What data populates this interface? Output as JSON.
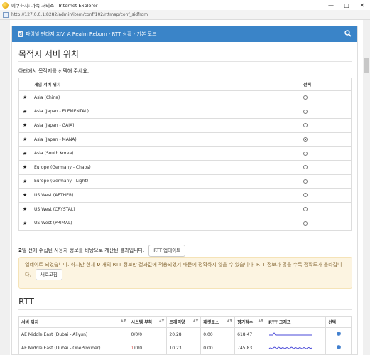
{
  "window": {
    "title": "미쿠하지: 가속 서비스 - Internet Explorer",
    "url": "http://127.0.0.1:8282/admin/item/conf/102/rttmap/conf_sidfrom"
  },
  "navbar": {
    "brand": "파이널 판타지 XIV: A Realm Reborn - RTT 상황 - 기본 모드"
  },
  "section": {
    "title": "목적지 서버 위치",
    "instruction": "아래에서 목적지를 선택해 주세요."
  },
  "server_table": {
    "headers": [
      "게임 서버 위치",
      "선택"
    ],
    "rows": [
      {
        "name": "Asia (China)",
        "selected": false
      },
      {
        "name": "Asia (Japan - ELEMENTAL)",
        "selected": false
      },
      {
        "name": "Asia (Japan - GAIA)",
        "selected": false
      },
      {
        "name": "Asia (Japan - MANA)",
        "selected": true
      },
      {
        "name": "Asia (South Korea)",
        "selected": false
      },
      {
        "name": "Europe (Germany - Chaos)",
        "selected": false
      },
      {
        "name": "Europe (Germany - Light)",
        "selected": false
      },
      {
        "name": "US West (AETHER)",
        "selected": false
      },
      {
        "name": "US West (CRYSTAL)",
        "selected": false
      },
      {
        "name": "US West (PRIMAL)",
        "selected": false
      }
    ]
  },
  "info": {
    "days": "2",
    "text": " 일 전에 수집된 사용자 정보를 바탕으로 계산된 결과입니다.",
    "button": "RTT 업데이트"
  },
  "alert": {
    "text_before": "업데이트 되었습니다. 하지만 현재 ",
    "count": "0",
    "text_after": " 개의 RTT 정보만 결과값에 적용되었기 때문에 정확하지 않을 수 있습니다. RTT 정보가 많을 수록 정확도가 올라갑니다.",
    "button": "새로고침"
  },
  "rtt": {
    "title": "RTT",
    "headers": [
      "서버 위치",
      "시스템 부하",
      "트래픽양",
      "패킷로스",
      "평가점수",
      "RTT 그래프",
      "선택"
    ],
    "rows": [
      {
        "name": "AE Middle East (Dubai - Aliyun)",
        "load_a": "0",
        "load_b": "0",
        "load_c": "0",
        "traffic": "20.28",
        "loss": "0.00",
        "score": "618.47",
        "load_red": false
      },
      {
        "name": "AE Middle East (Dubai - OneProvider)",
        "load_a": "1",
        "load_b": "0",
        "load_c": "0",
        "traffic": "10.23",
        "loss": "0.00",
        "score": "745.83",
        "load_red": true
      }
    ]
  },
  "colors": {
    "navbar": "#3a84c8",
    "alert_bg": "#fcf4e1",
    "alert_text": "#8a6d3b",
    "graph_line": "#4a4ad8"
  }
}
